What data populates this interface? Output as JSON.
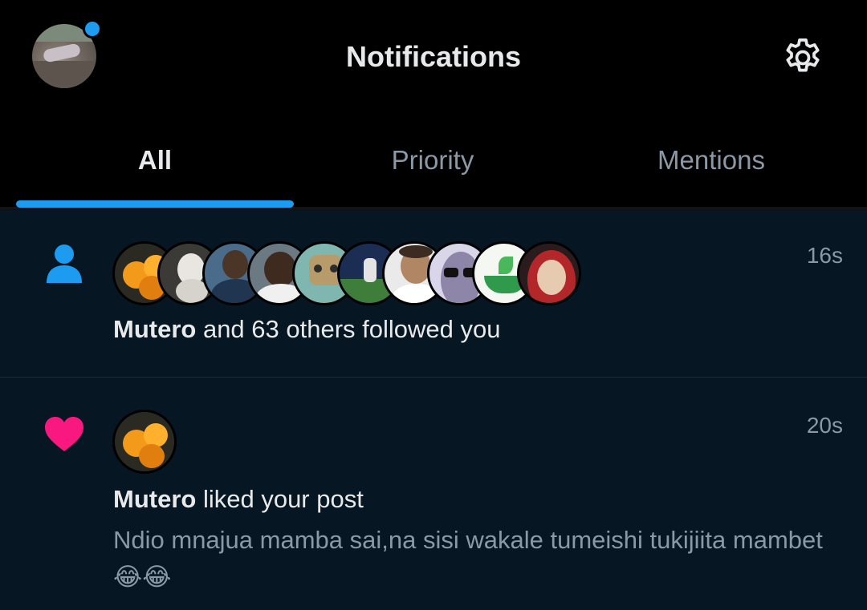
{
  "header": {
    "title": "Notifications",
    "profile_icon": "profile-avatar",
    "settings_icon": "gear-icon",
    "accent": "#1d9bf0"
  },
  "tabs": [
    {
      "label": "All",
      "active": true
    },
    {
      "label": "Priority",
      "active": false
    },
    {
      "label": "Mentions",
      "active": false
    }
  ],
  "notifications": [
    {
      "type_icon": "person-icon",
      "time": "16s",
      "actor": "Mutero",
      "text": "and 63 others followed you",
      "avatar_count": 10
    },
    {
      "type_icon": "heart-icon",
      "time": "20s",
      "actor": "Mutero",
      "text": "liked your post",
      "preview": "Ndio mnajua mamba sai,na sisi wakale tumeishi tukijiita mambet😂😂",
      "heart_color": "#f91880"
    }
  ]
}
